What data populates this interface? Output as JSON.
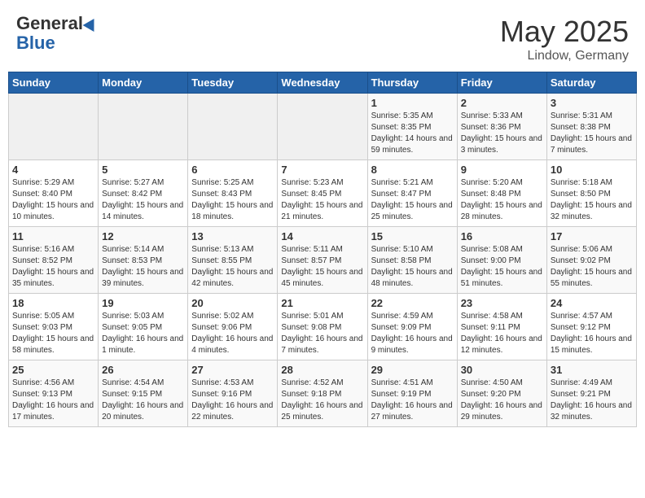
{
  "header": {
    "logo_general": "General",
    "logo_blue": "Blue",
    "month_title": "May 2025",
    "location": "Lindow, Germany"
  },
  "weekdays": [
    "Sunday",
    "Monday",
    "Tuesday",
    "Wednesday",
    "Thursday",
    "Friday",
    "Saturday"
  ],
  "weeks": [
    [
      {
        "day": "",
        "sunrise": "",
        "sunset": "",
        "daylight": ""
      },
      {
        "day": "",
        "sunrise": "",
        "sunset": "",
        "daylight": ""
      },
      {
        "day": "",
        "sunrise": "",
        "sunset": "",
        "daylight": ""
      },
      {
        "day": "",
        "sunrise": "",
        "sunset": "",
        "daylight": ""
      },
      {
        "day": "1",
        "sunrise": "Sunrise: 5:35 AM",
        "sunset": "Sunset: 8:35 PM",
        "daylight": "Daylight: 14 hours and 59 minutes."
      },
      {
        "day": "2",
        "sunrise": "Sunrise: 5:33 AM",
        "sunset": "Sunset: 8:36 PM",
        "daylight": "Daylight: 15 hours and 3 minutes."
      },
      {
        "day": "3",
        "sunrise": "Sunrise: 5:31 AM",
        "sunset": "Sunset: 8:38 PM",
        "daylight": "Daylight: 15 hours and 7 minutes."
      }
    ],
    [
      {
        "day": "4",
        "sunrise": "Sunrise: 5:29 AM",
        "sunset": "Sunset: 8:40 PM",
        "daylight": "Daylight: 15 hours and 10 minutes."
      },
      {
        "day": "5",
        "sunrise": "Sunrise: 5:27 AM",
        "sunset": "Sunset: 8:42 PM",
        "daylight": "Daylight: 15 hours and 14 minutes."
      },
      {
        "day": "6",
        "sunrise": "Sunrise: 5:25 AM",
        "sunset": "Sunset: 8:43 PM",
        "daylight": "Daylight: 15 hours and 18 minutes."
      },
      {
        "day": "7",
        "sunrise": "Sunrise: 5:23 AM",
        "sunset": "Sunset: 8:45 PM",
        "daylight": "Daylight: 15 hours and 21 minutes."
      },
      {
        "day": "8",
        "sunrise": "Sunrise: 5:21 AM",
        "sunset": "Sunset: 8:47 PM",
        "daylight": "Daylight: 15 hours and 25 minutes."
      },
      {
        "day": "9",
        "sunrise": "Sunrise: 5:20 AM",
        "sunset": "Sunset: 8:48 PM",
        "daylight": "Daylight: 15 hours and 28 minutes."
      },
      {
        "day": "10",
        "sunrise": "Sunrise: 5:18 AM",
        "sunset": "Sunset: 8:50 PM",
        "daylight": "Daylight: 15 hours and 32 minutes."
      }
    ],
    [
      {
        "day": "11",
        "sunrise": "Sunrise: 5:16 AM",
        "sunset": "Sunset: 8:52 PM",
        "daylight": "Daylight: 15 hours and 35 minutes."
      },
      {
        "day": "12",
        "sunrise": "Sunrise: 5:14 AM",
        "sunset": "Sunset: 8:53 PM",
        "daylight": "Daylight: 15 hours and 39 minutes."
      },
      {
        "day": "13",
        "sunrise": "Sunrise: 5:13 AM",
        "sunset": "Sunset: 8:55 PM",
        "daylight": "Daylight: 15 hours and 42 minutes."
      },
      {
        "day": "14",
        "sunrise": "Sunrise: 5:11 AM",
        "sunset": "Sunset: 8:57 PM",
        "daylight": "Daylight: 15 hours and 45 minutes."
      },
      {
        "day": "15",
        "sunrise": "Sunrise: 5:10 AM",
        "sunset": "Sunset: 8:58 PM",
        "daylight": "Daylight: 15 hours and 48 minutes."
      },
      {
        "day": "16",
        "sunrise": "Sunrise: 5:08 AM",
        "sunset": "Sunset: 9:00 PM",
        "daylight": "Daylight: 15 hours and 51 minutes."
      },
      {
        "day": "17",
        "sunrise": "Sunrise: 5:06 AM",
        "sunset": "Sunset: 9:02 PM",
        "daylight": "Daylight: 15 hours and 55 minutes."
      }
    ],
    [
      {
        "day": "18",
        "sunrise": "Sunrise: 5:05 AM",
        "sunset": "Sunset: 9:03 PM",
        "daylight": "Daylight: 15 hours and 58 minutes."
      },
      {
        "day": "19",
        "sunrise": "Sunrise: 5:03 AM",
        "sunset": "Sunset: 9:05 PM",
        "daylight": "Daylight: 16 hours and 1 minute."
      },
      {
        "day": "20",
        "sunrise": "Sunrise: 5:02 AM",
        "sunset": "Sunset: 9:06 PM",
        "daylight": "Daylight: 16 hours and 4 minutes."
      },
      {
        "day": "21",
        "sunrise": "Sunrise: 5:01 AM",
        "sunset": "Sunset: 9:08 PM",
        "daylight": "Daylight: 16 hours and 7 minutes."
      },
      {
        "day": "22",
        "sunrise": "Sunrise: 4:59 AM",
        "sunset": "Sunset: 9:09 PM",
        "daylight": "Daylight: 16 hours and 9 minutes."
      },
      {
        "day": "23",
        "sunrise": "Sunrise: 4:58 AM",
        "sunset": "Sunset: 9:11 PM",
        "daylight": "Daylight: 16 hours and 12 minutes."
      },
      {
        "day": "24",
        "sunrise": "Sunrise: 4:57 AM",
        "sunset": "Sunset: 9:12 PM",
        "daylight": "Daylight: 16 hours and 15 minutes."
      }
    ],
    [
      {
        "day": "25",
        "sunrise": "Sunrise: 4:56 AM",
        "sunset": "Sunset: 9:13 PM",
        "daylight": "Daylight: 16 hours and 17 minutes."
      },
      {
        "day": "26",
        "sunrise": "Sunrise: 4:54 AM",
        "sunset": "Sunset: 9:15 PM",
        "daylight": "Daylight: 16 hours and 20 minutes."
      },
      {
        "day": "27",
        "sunrise": "Sunrise: 4:53 AM",
        "sunset": "Sunset: 9:16 PM",
        "daylight": "Daylight: 16 hours and 22 minutes."
      },
      {
        "day": "28",
        "sunrise": "Sunrise: 4:52 AM",
        "sunset": "Sunset: 9:18 PM",
        "daylight": "Daylight: 16 hours and 25 minutes."
      },
      {
        "day": "29",
        "sunrise": "Sunrise: 4:51 AM",
        "sunset": "Sunset: 9:19 PM",
        "daylight": "Daylight: 16 hours and 27 minutes."
      },
      {
        "day": "30",
        "sunrise": "Sunrise: 4:50 AM",
        "sunset": "Sunset: 9:20 PM",
        "daylight": "Daylight: 16 hours and 29 minutes."
      },
      {
        "day": "31",
        "sunrise": "Sunrise: 4:49 AM",
        "sunset": "Sunset: 9:21 PM",
        "daylight": "Daylight: 16 hours and 32 minutes."
      }
    ]
  ]
}
